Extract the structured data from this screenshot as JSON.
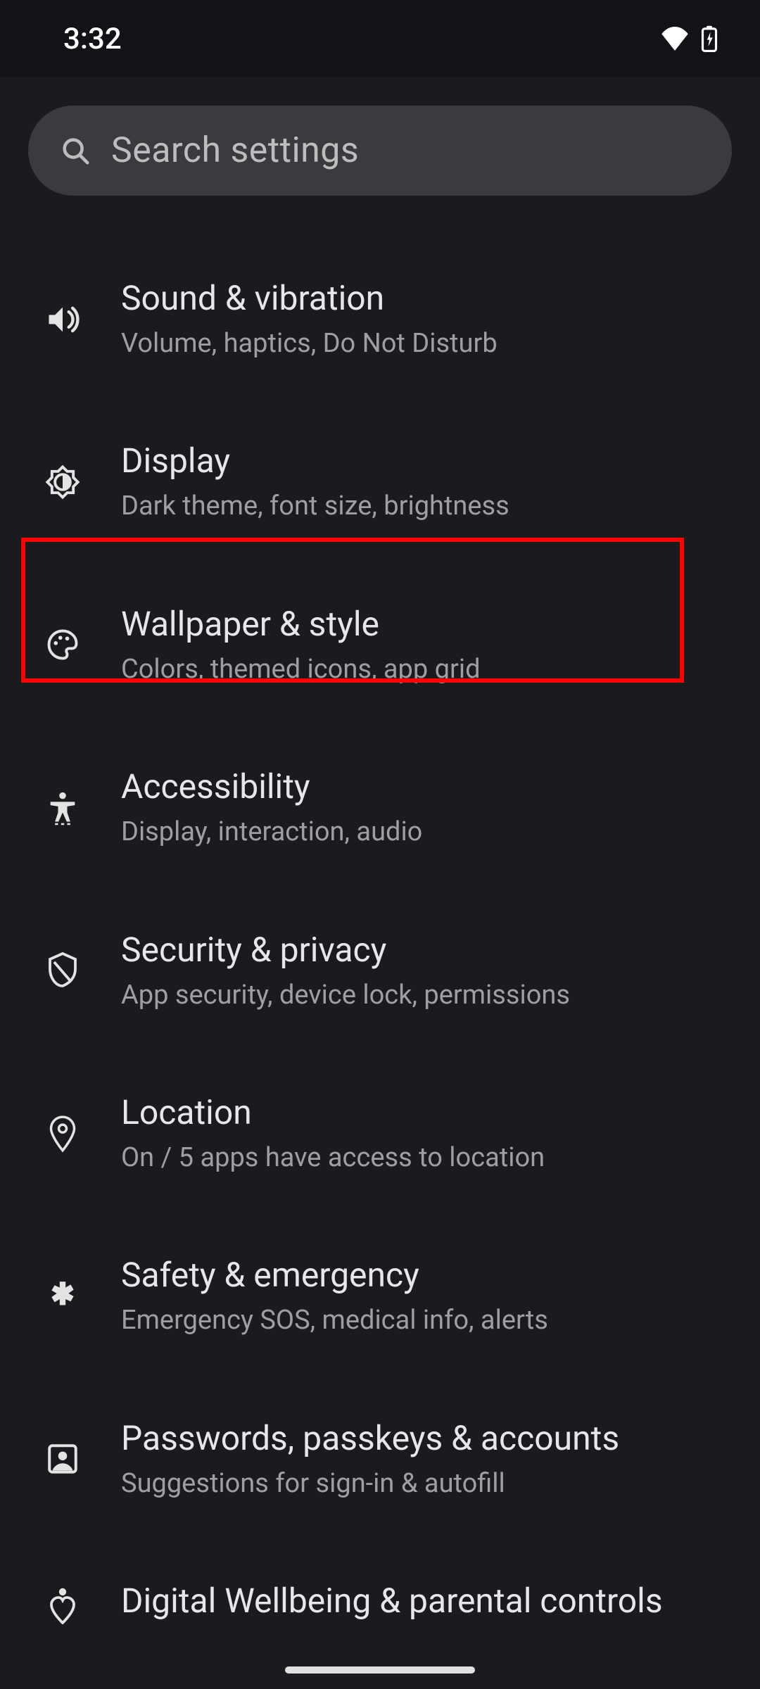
{
  "status": {
    "time": "3:32"
  },
  "search": {
    "placeholder": "Search settings"
  },
  "items": [
    {
      "title": "Sound & vibration",
      "sub": "Volume, haptics, Do Not Disturb"
    },
    {
      "title": "Display",
      "sub": "Dark theme, font size, brightness"
    },
    {
      "title": "Wallpaper & style",
      "sub": "Colors, themed icons, app grid"
    },
    {
      "title": "Accessibility",
      "sub": "Display, interaction, audio"
    },
    {
      "title": "Security & privacy",
      "sub": "App security, device lock, permissions"
    },
    {
      "title": "Location",
      "sub": "On / 5 apps have access to location"
    },
    {
      "title": "Safety & emergency",
      "sub": "Emergency SOS, medical info, alerts"
    },
    {
      "title": "Passwords, passkeys & accounts",
      "sub": "Suggestions for sign-in & autofill"
    },
    {
      "title": "Digital Wellbeing & parental controls",
      "sub": ""
    }
  ]
}
